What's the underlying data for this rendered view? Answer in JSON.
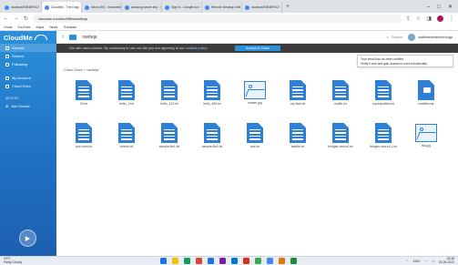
{
  "browser": {
    "tabs": [
      {
        "label": "localhost/WEB/FhO/",
        "active": false
      },
      {
        "label": "CloudMe - The Easy",
        "active": true
      },
      {
        "label": "Inbox (90) - nsramesh",
        "active": false
      },
      {
        "label": "amazing secret key",
        "active": false
      },
      {
        "label": "Sign in - Google Acc",
        "active": false
      },
      {
        "label": "Remote Desktop Soft",
        "active": false
      },
      {
        "label": "localhost/WEB/FhO/",
        "active": false
      }
    ],
    "new_tab": "+",
    "url": "cloudme.com/en/#files/raviteja",
    "bookmarks": [
      "Gmail",
      "YouTube",
      "Maps",
      "News",
      "Translate"
    ]
  },
  "app": {
    "logo": "CloudMe",
    "sidebar": {
      "items": [
        {
          "label": "Synced",
          "active": true
        },
        {
          "label": "Shared",
          "active": false
        },
        {
          "label": "Following",
          "active": false
        },
        {
          "label": "My Account",
          "active": false
        },
        {
          "label": "Cloud Drive",
          "active": false
        }
      ],
      "devices_label": "DEVICES",
      "add_device": "Add Device"
    },
    "header": {
      "folder": "raviteja",
      "search_label": "Search",
      "user_name": "saitdirmestechnology"
    },
    "cookie_banner": {
      "text": "Our site uses cookies. By continuing to use our site you are agreeing to our",
      "link": "cookies policy.",
      "accept": "Accept & Close"
    },
    "notice": {
      "line1": "Your email has not been verified.",
      "line2": "Verify it now and gain access to more functionality."
    },
    "breadcrumb": "Cloud Drive > raviteja",
    "files": [
      {
        "name": "30.txt",
        "kind": "doc"
      },
      {
        "name": "hello_1.txt",
        "kind": "doc"
      },
      {
        "name": "hello_123.txt",
        "kind": "doc"
      },
      {
        "name": "hello_456.txt",
        "kind": "doc"
      },
      {
        "name": "imsam.jpg",
        "kind": "image"
      },
      {
        "name": "my data.txt",
        "kind": "doc"
      },
      {
        "name": "myfile.txt",
        "kind": "doc"
      },
      {
        "name": "myoutputtext.txt",
        "kind": "doc"
      },
      {
        "name": "newfiles.rar",
        "kind": "zip"
      },
      {
        "name": "pan from.txt",
        "kind": "doc"
      },
      {
        "name": "redinfo.txt",
        "kind": "doc"
      },
      {
        "name": "sample file1.txt",
        "kind": "doc"
      },
      {
        "name": "sample file2.txt",
        "kind": "doc"
      },
      {
        "name": "test.txt",
        "kind": "doc"
      },
      {
        "name": "testfile.txt",
        "kind": "doc"
      },
      {
        "name": "thingair new.s4.txt",
        "kind": "doc"
      },
      {
        "name": "thingair new.s4.1.txt",
        "kind": "doc"
      },
      {
        "name": "tiki.jpg",
        "kind": "image"
      }
    ]
  },
  "taskbar": {
    "weather_temp": "29°C",
    "weather_text": "Partly Cloudy",
    "lang": "ENG",
    "time": "18:38",
    "date": "24-08-2022",
    "icon_colors": [
      "#1a73e8",
      "#fbbc04",
      "#0f9d58",
      "#db4437",
      "#1a73e8",
      "#7b1fa2",
      "#0078d4",
      "#d93025",
      "#34a853",
      "#4285f4",
      "#e8710a",
      "#1e8e3e"
    ]
  }
}
